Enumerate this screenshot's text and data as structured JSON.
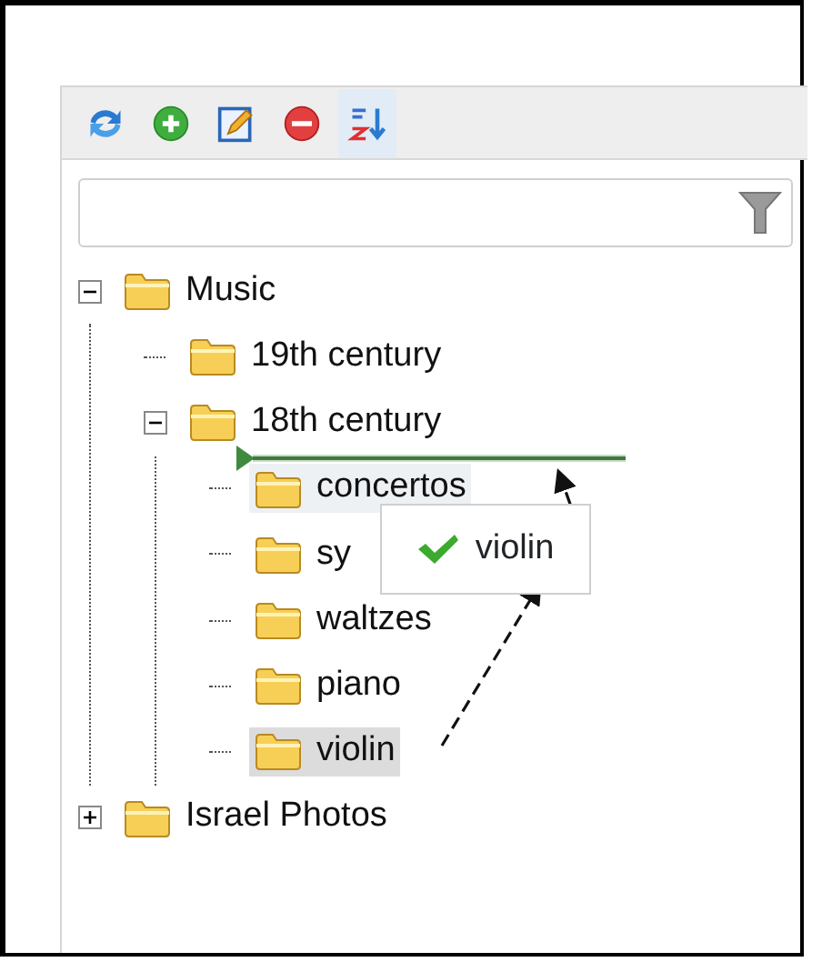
{
  "toolbar": {
    "buttons": [
      {
        "kind": "refresh",
        "selected": false
      },
      {
        "kind": "add",
        "selected": false
      },
      {
        "kind": "edit",
        "selected": false
      },
      {
        "kind": "delete",
        "selected": false
      },
      {
        "kind": "sort",
        "selected": true
      }
    ]
  },
  "tree": [
    {
      "label": "Music",
      "expanded": true,
      "selected": false,
      "hovered": false,
      "children": [
        {
          "label": "19th century",
          "selected": false,
          "hovered": false
        },
        {
          "label": "18th century",
          "expanded": true,
          "selected": false,
          "hovered": false,
          "children": [
            {
              "label": "concertos",
              "selected": false,
              "hovered": true
            },
            {
              "label": "sy",
              "selected": false,
              "hovered": false
            },
            {
              "label": "waltzes",
              "selected": false,
              "hovered": false
            },
            {
              "label": "piano",
              "selected": false,
              "hovered": false
            },
            {
              "label": "violin",
              "selected": true,
              "hovered": false
            }
          ]
        }
      ]
    },
    {
      "label": "Israel Photos",
      "expanded": false,
      "selected": false,
      "hovered": false
    }
  ],
  "drag_tooltip": {
    "label": "violin",
    "accepted": true
  }
}
